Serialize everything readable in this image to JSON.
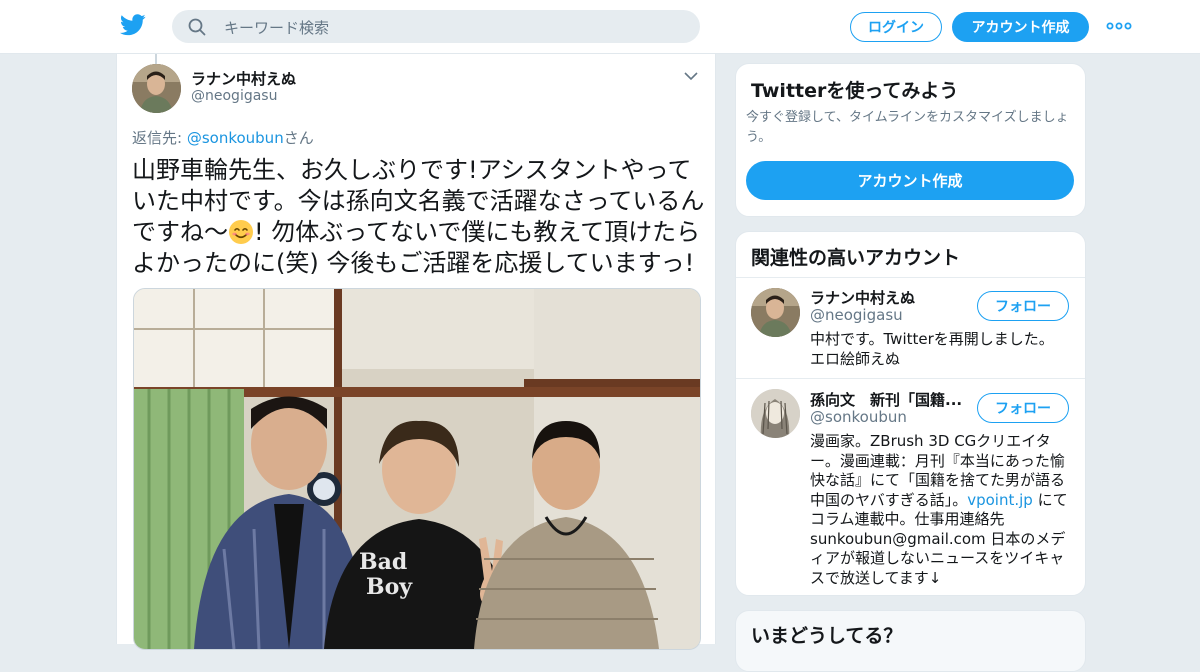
{
  "header": {
    "search_placeholder": "キーワード検索",
    "login_label": "ログイン",
    "signup_label": "アカウント作成"
  },
  "tweet": {
    "author_name": "ラナン中村えぬ",
    "author_handle": "@neogigasu",
    "reply_prefix": "返信先: ",
    "reply_mention": "@sonkoubun",
    "reply_suffix": "さん",
    "text_before_emoji": "山野車輪先生、お久しぶりです!アシスタントやっていた中村です。今は孫向文名義で活躍なさっているんですね～",
    "text_after_emoji": "! 勿体ぶってないで僕にも教えて頂けたらよかったのに(笑) 今後もご活躍を応援していますっ!"
  },
  "signup_card": {
    "title": "Twitterを使ってみよう",
    "subtitle": "今すぐ登録して、タイムラインをカスタマイズしましょう。",
    "cta_label": "アカウント作成"
  },
  "related": {
    "title": "関連性の高いアカウント",
    "accounts": [
      {
        "name": "ラナン中村えぬ",
        "handle": "@neogigasu",
        "follow_label": "フォロー",
        "bio": "中村です。Twitterを再開しました。 エロ絵師えぬ"
      },
      {
        "name": "孫向文　新刊「国籍...",
        "handle": "@sonkoubun",
        "follow_label": "フォロー",
        "bio_before_link": "漫画家。ZBrush 3D CGクリエイター。漫画連載：月刊『本当にあった愉快な話』にて「国籍を捨てた男が語る中国のヤバすぎる話」。",
        "bio_link": "vpoint.jp",
        "bio_after_link": " にてコラム連載中。仕事用連絡先 sunkoubun@gmail.com 日本のメディアが報道しないニュースをツイキャスで放送してます↓"
      }
    ]
  },
  "trends_card": {
    "title": "いまどうしてる？"
  },
  "colors": {
    "accent": "#1da1f2",
    "link": "#1b95e0",
    "muted": "#657786",
    "background": "#e6ecf0"
  },
  "icons": [
    "twitter-bird-icon",
    "search-icon",
    "more-dots-icon",
    "chevron-down-icon",
    "smiling-face-emoji"
  ]
}
